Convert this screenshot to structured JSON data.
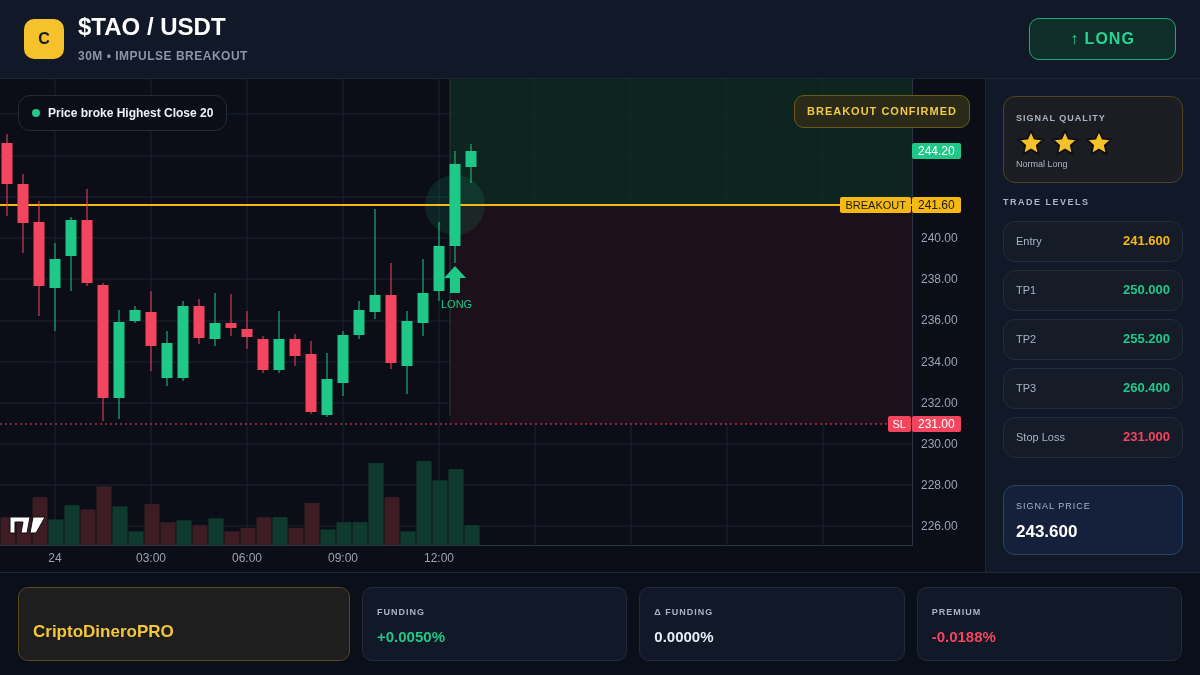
{
  "header": {
    "logo_letter": "C",
    "title": "$TAO / USDT",
    "subtitle": "30M • IMPULSE BREAKOUT",
    "action_button": "↑ LONG"
  },
  "chart": {
    "note": {
      "text": "Price broke Highest Close 20",
      "color": "#22c98a"
    },
    "badge": "BREAKOUT CONFIRMED",
    "price_labels": [
      {
        "kind": "last",
        "value": "244.20"
      },
      {
        "kind": "breakout",
        "label": "BREAKOUT",
        "value": "241.60"
      },
      {
        "kind": "stop",
        "label": "SL",
        "value": "231.00"
      }
    ],
    "y_axis_labels": [
      "240.00",
      "238.00",
      "236.00",
      "234.00",
      "232.00",
      "230.00",
      "228.00",
      "226.00"
    ],
    "x_axis_labels": [
      "24",
      "03:00",
      "06:00",
      "09:00",
      "12:00"
    ],
    "signal_marker": "LONG"
  },
  "signal_quality": {
    "title": "SIGNAL QUALITY",
    "stars": 3,
    "caption": "Normal Long"
  },
  "trade_levels": {
    "title": "TRADE LEVELS",
    "rows": [
      {
        "label": "Entry",
        "value": "241.600",
        "kind": "entry"
      },
      {
        "label": "TP1",
        "value": "250.000",
        "kind": "target"
      },
      {
        "label": "TP2",
        "value": "255.200",
        "kind": "target"
      },
      {
        "label": "TP3",
        "value": "260.400",
        "kind": "target"
      },
      {
        "label": "Stop Loss",
        "value": "231.000",
        "kind": "stop"
      }
    ]
  },
  "signal_price": {
    "label": "SIGNAL PRICE",
    "value": "243.600"
  },
  "footer": {
    "brand": "CriptoDineroPRO",
    "stats": [
      {
        "label": "FUNDING",
        "value": "+0.0050%",
        "kind": "positive"
      },
      {
        "label": "Δ FUNDING",
        "value": "0.0000%",
        "kind": "neutral"
      },
      {
        "label": "PREMIUM",
        "value": "-0.0188%",
        "kind": "negative"
      }
    ]
  }
}
